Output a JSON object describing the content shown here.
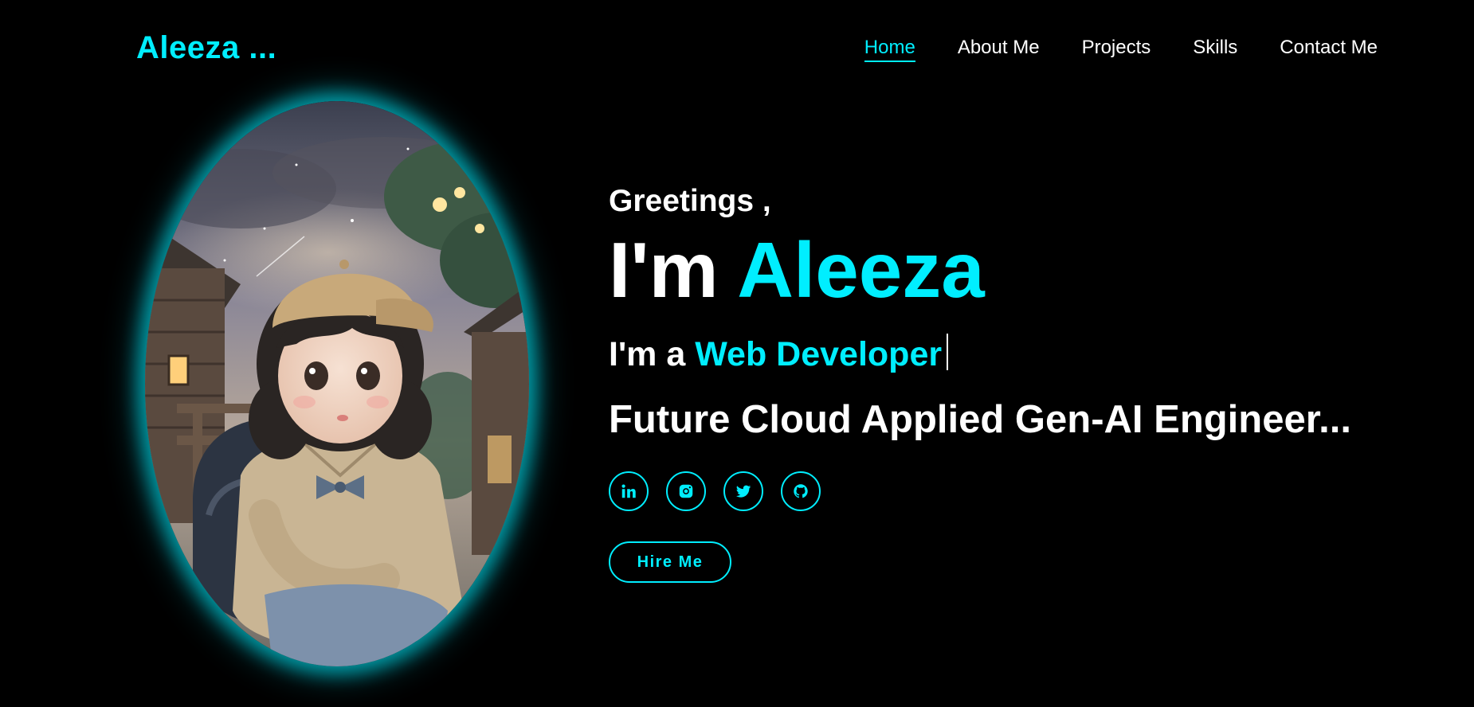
{
  "header": {
    "logo": "Aleeza ...",
    "nav": [
      {
        "label": "Home",
        "active": true
      },
      {
        "label": "About Me",
        "active": false
      },
      {
        "label": "Projects",
        "active": false
      },
      {
        "label": "Skills",
        "active": false
      },
      {
        "label": "Contact Me",
        "active": false
      }
    ]
  },
  "hero": {
    "greeting": "Greetings ,",
    "title_prefix": "I'm",
    "title_name": "Aleeza",
    "role_prefix": "I'm a",
    "role_highlight": "Web Developer",
    "tagline": "Future Cloud Applied Gen-AI Engineer...",
    "socials": [
      {
        "icon": "linkedin-icon"
      },
      {
        "icon": "instagram-icon"
      },
      {
        "icon": "twitter-icon"
      },
      {
        "icon": "github-icon"
      }
    ],
    "cta_label": "Hire Me"
  },
  "portrait": {
    "subject": "illustrated-girl-portrait"
  },
  "colors": {
    "accent": "#00eeff",
    "background": "#000000",
    "text": "#ffffff"
  }
}
